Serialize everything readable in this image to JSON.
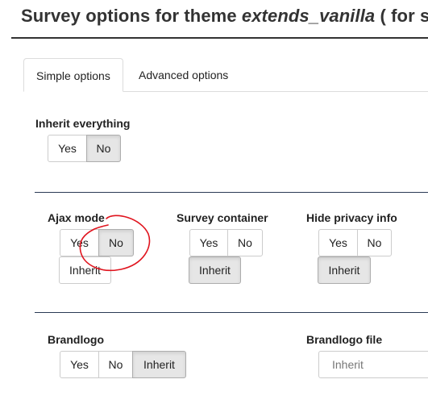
{
  "page": {
    "title_prefix": "Survey options for theme ",
    "title_theme": "extends_vanilla",
    "title_suffix": " ( for s"
  },
  "tabs": [
    {
      "label": "Simple options",
      "active": true
    },
    {
      "label": "Advanced options",
      "active": false
    }
  ],
  "inherit_everything": {
    "label": "Inherit everything",
    "yes": "Yes",
    "no": "No",
    "selected": "No"
  },
  "ajax_mode": {
    "label": "Ajax mode",
    "yes": "Yes",
    "no": "No",
    "inherit": "Inherit",
    "selected": "No"
  },
  "survey_container": {
    "label": "Survey container",
    "yes": "Yes",
    "no": "No",
    "inherit": "Inherit",
    "selected": "Inherit"
  },
  "hide_privacy_info": {
    "label": "Hide privacy info",
    "yes": "Yes",
    "no": "No",
    "inherit": "Inherit",
    "selected": "Inherit"
  },
  "brandlogo": {
    "label": "Brandlogo",
    "yes": "Yes",
    "no": "No",
    "inherit": "Inherit",
    "selected": "Inherit"
  },
  "brandlogo_file": {
    "label": "Brandlogo file",
    "value": "Inherit"
  },
  "colors": {
    "annotation": "#e0141e",
    "divider": "#2a3a55",
    "selected_bg": "#e6e6e6"
  }
}
